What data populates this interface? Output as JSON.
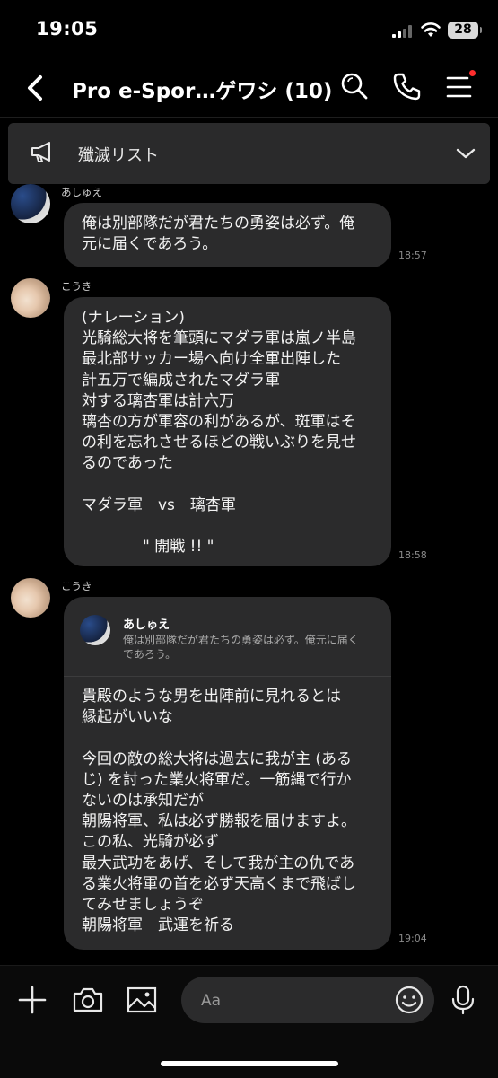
{
  "status": {
    "time": "19:05",
    "battery": "28"
  },
  "header": {
    "title": "Pro e-Spor…ゲワシ (10)"
  },
  "announcement": {
    "text": "殲滅リスト"
  },
  "messages": [
    {
      "sender": "あしゅえ",
      "text": "俺は別部隊だが君たちの勇姿は必ず。俺\n元に届くであろう。",
      "time": "18:57"
    },
    {
      "sender": "こうき",
      "text": "(ナレーション)\n光騎総大将を筆頭にマダラ軍は嵐ノ半島\n最北部サッカー場へ向け全軍出陣した\n計五万で編成されたマダラ軍\n対する璃杏軍は計六万\n璃杏の方が軍容の利があるが、斑軍はそ\nの利を忘れさせるほどの戦いぶりを見せ\nるのであった\n\nマダラ軍　vs　璃杏軍\n\n　　　　\" 開戦 !! \"",
      "time": "18:58"
    },
    {
      "sender": "こうき",
      "reply": {
        "name": "あしゅえ",
        "text": "俺は別部隊だが君たちの勇姿は必ず。俺元に届く\nであろう。"
      },
      "text": "貴殿のような男を出陣前に見れるとは\n縁起がいいな\n\n今回の敵の総大将は過去に我が主 (ある\nじ) を討った業火将軍だ。一筋縄で行か\nないのは承知だが\n朝陽将軍、私は必ず勝報を届けますよ。\nこの私、光騎が必ず\n最大武功をあげ、そして我が主の仇であ\nる業火将軍の首を必ず天高くまで飛ばし\nてみせましょうぞ\n朝陽将軍　武運を祈る",
      "time": "19:04"
    }
  ],
  "input": {
    "placeholder": "Aa"
  }
}
